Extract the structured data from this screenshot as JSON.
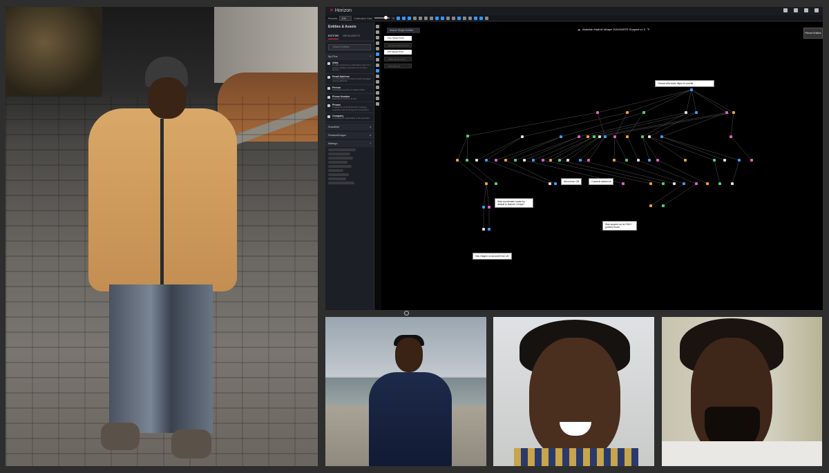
{
  "app": {
    "logo_text": "Horizon",
    "toolbar": {
      "results_label": "Results",
      "results_value": "100",
      "collection_size_label": "Collection Size",
      "collection_size_value": "75"
    },
    "sidebar": {
      "title": "Entities & Assets",
      "tabs": [
        "ENTITIES",
        "MEDIA ASSETS"
      ],
      "search_placeholder": "Search Entities",
      "section_my_pins": "My Pins",
      "items": [
        {
          "title": "Alias",
          "desc": "An alias represents an alternative name for a person, usually a username for an online account"
        },
        {
          "title": "Email Address",
          "desc": "An email address by which emails messages may be delivered"
        },
        {
          "title": "Person",
          "desc": "Represents a person or his/her profile"
        },
        {
          "title": "Phone Number",
          "desc": "Represents a phone number"
        },
        {
          "title": "Phrase",
          "desc": "A sequence of words that form meaning, especially when forming part of a sentence"
        },
        {
          "title": "Company",
          "desc": "A company or organization in the real world"
        }
      ],
      "sections": [
        "SocialNet",
        "ShadowDragon",
        "Maltego"
      ]
    },
    "canvas": {
      "graph_title": "Abdullah Hadi Al Uthayri SOLIDASTE Suspect v1.3",
      "search_button": "Search Single Entities",
      "select_buttons": [
        "TAG SELECTION",
        "DELETE SELECTION",
        "PIN SELECTION",
        "HIDE SELECTION",
        "EXPAND ALL"
      ],
      "right_tag": "Pinned Entities",
      "notes": [
        "Thread with bosts https://x.com/ite...",
        "Alexa from GB",
        "Contacts tabbed at",
        "Was coordinates locate by default to Nairobi, Kenya?",
        "Was suspect as he ONLY (police) found",
        "Has images on account from UK"
      ]
    }
  },
  "colors": {
    "accent_red": "#e33a44",
    "node_blue": "#3a9cff",
    "node_pink": "#e060c0",
    "node_orange": "#f0a030",
    "node_green": "#4ad07a"
  }
}
